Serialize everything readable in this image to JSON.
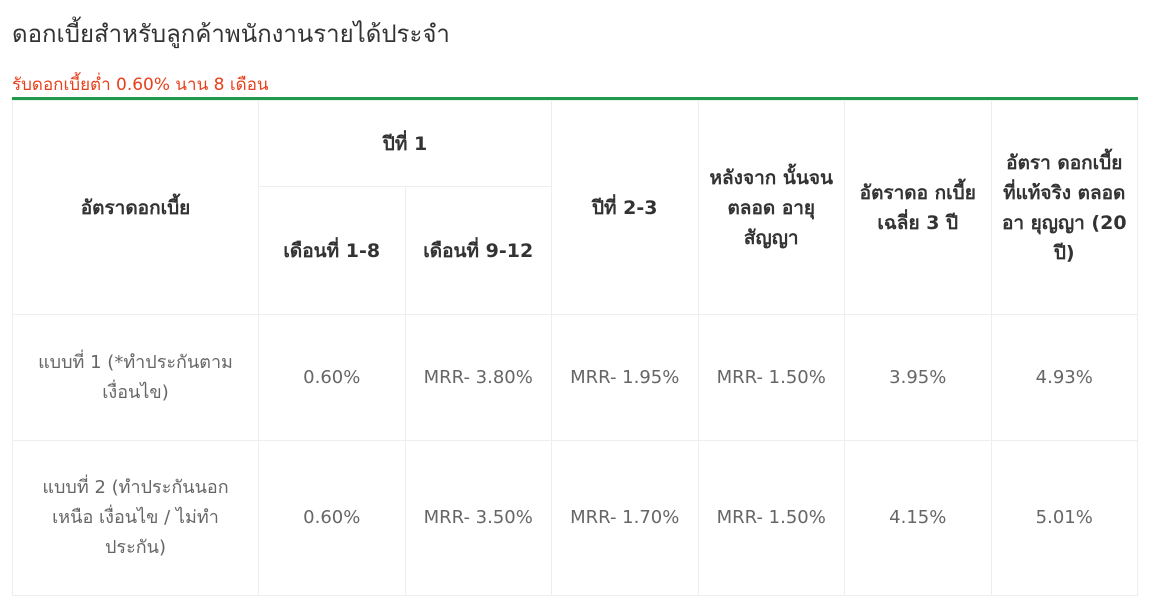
{
  "page_title": "ดอกเบี้ยสำหรับลูกค้าพนักงานรายได้ประจำ",
  "subtitle": "รับดอกเบี้ยต่ำ 0.60% นาน 8 เดือน",
  "table": {
    "headers": {
      "interest_rate": "อัตราดอกเบี้ย",
      "year1": "ปีที่ 1",
      "month_1_8": "เดือนที่ 1-8",
      "month_9_12": "เดือนที่ 9-12",
      "year_2_3": "ปีที่ 2-3",
      "after_until_end": "หลังจาก นั้นจน ตลอด อายุ สัญญา",
      "avg_3y": "อัตราดอ กเบี้ย เฉลี่ย 3 ปี",
      "effective_20y": "อัตรา ดอกเบี้ย ที่แท้จริง ตลอดอา ยุญญา (20 ปี)"
    },
    "rows": [
      {
        "label": "แบบที่ 1 (*ทำประกันตาม เงื่อนไข)",
        "m1_8": "0.60%",
        "m9_12": "MRR- 3.80%",
        "y2_3": "MRR- 1.95%",
        "after": "MRR- 1.50%",
        "avg3": "3.95%",
        "eff20": "4.93%"
      },
      {
        "label": "แบบที่ 2 (ทำประกันนอกเหนือ เงื่อนไข / ไม่ทำ ประกัน)",
        "m1_8": "0.60%",
        "m9_12": "MRR- 3.50%",
        "y2_3": "MRR- 1.70%",
        "after": "MRR- 1.50%",
        "avg3": "4.15%",
        "eff20": "5.01%"
      }
    ]
  }
}
